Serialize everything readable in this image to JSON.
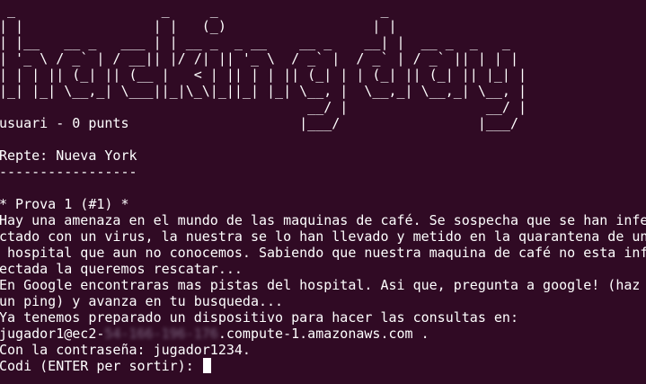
{
  "banner": {
    "art": [
      " _                  _     _                    _              ",
      "| |                | |   (_)                  | |             ",
      "| |__   __ _   ___ | | __ _  _ __    __ _    __| |  __ _  _   _ ",
      "| '_ \\ / _` | / __|| |/ /| || '_ \\  / _` |  / _` | / _` || | | |",
      "| | | || (_| || (__ |   < | || | | || (_| | | (_| || (_| || |_| |",
      "|_| |_| \\__,_| \\___||_|\\_\\|_||_| |_| \\__, |  \\__,_| \\__,_| \\__, |",
      "                                      __/ |                 __/ |",
      "usuari - 0 punts                     |___/                 |___/ "
    ]
  },
  "challenge": {
    "label": "Repte: Nueva York",
    "divider": "-----------------"
  },
  "test": {
    "heading": "* Prova 1 (#1) *",
    "text_lines": [
      "Hay una amenaza en el mundo de las maquinas de café. Se sospecha que se han infe",
      "ctado con un virus, la nuestra se lo han llevado y metido en la quarantena de un",
      " hospital que aun no conocemos. Sabiendo que nuestra maquina de café no esta inf",
      "ectada la queremos rescatar...",
      "En Google encontraras mas pistas del hospital. Asi que, pregunta a google! (haz",
      "un ping) y avanza en tu busqueda...",
      "Ya tenemos preparado un dispositivo para hacer las consultas en:"
    ],
    "host_prefix": "jugador1@ec2-",
    "host_redacted": "54-166-196-176",
    "host_suffix": ".compute-1.amazonaws.com .",
    "password_line": "Con la contraseña: jugador1234."
  },
  "prompt": {
    "text": "Codi (ENTER per sortir): "
  }
}
